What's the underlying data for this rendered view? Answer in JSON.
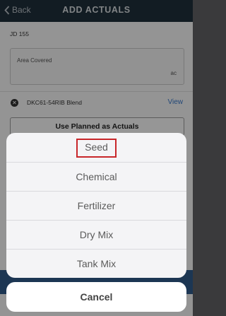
{
  "navbar": {
    "back_label": "Back",
    "title": "ADD ACTUALS"
  },
  "form": {
    "equipment": "JD 155",
    "area_label": "Area Covered",
    "area_unit": "ac",
    "product": "DKC61-54RIB Blend",
    "view_link": "View",
    "planned_button": "Use Planned as Actuals"
  },
  "action_sheet": {
    "options": [
      "Seed",
      "Chemical",
      "Fertilizer",
      "Dry Mix",
      "Tank Mix"
    ],
    "highlighted": "Seed",
    "highlight_color": "#c8262a",
    "cancel_label": "Cancel"
  },
  "colors": {
    "navbar": "#1e2f3b",
    "link": "#3a78c9",
    "bottom_bar": "#2f5a8a"
  }
}
